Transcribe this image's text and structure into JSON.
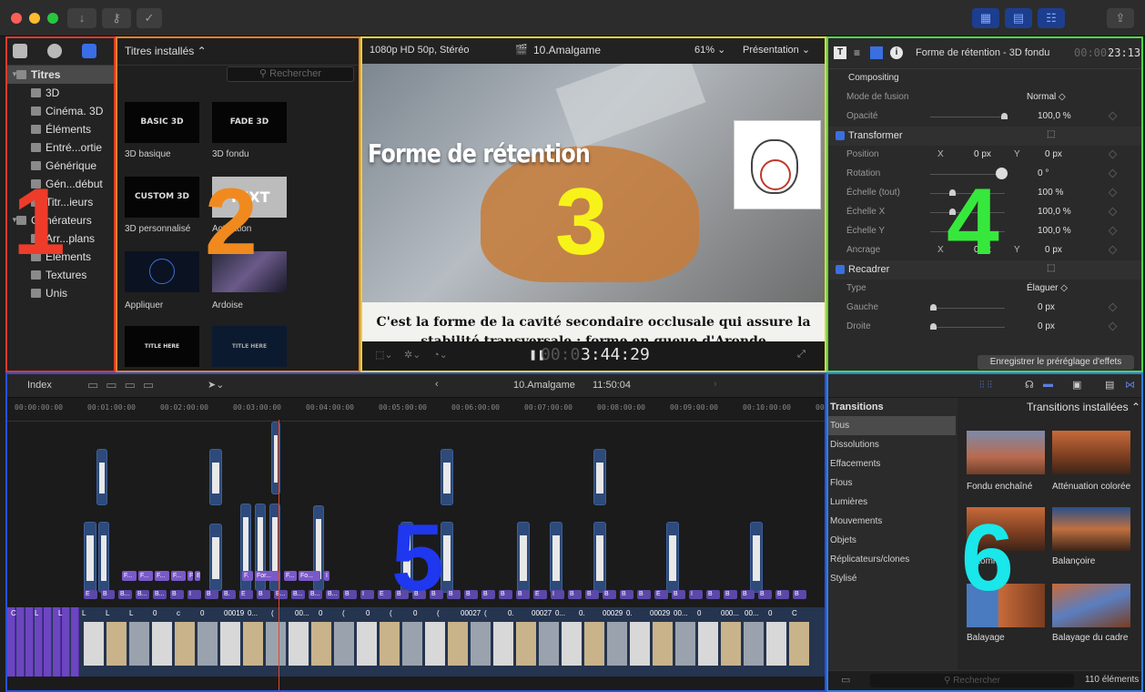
{
  "toolbar": {
    "import_icon": "download-arrow-icon",
    "keywords_icon": "key-icon",
    "background_tasks_icon": "checkmark-check-icon",
    "share_icon": "share-icon"
  },
  "sidebar": {
    "items": [
      {
        "label": "Titres",
        "level": 0,
        "selected": true,
        "expanded": true
      },
      {
        "label": "3D",
        "level": 1
      },
      {
        "label": "Cinéma. 3D",
        "level": 1
      },
      {
        "label": "Éléments",
        "level": 1
      },
      {
        "label": "Entré...ortie",
        "level": 1
      },
      {
        "label": "Générique",
        "level": 1
      },
      {
        "label": "Gén...début",
        "level": 1
      },
      {
        "label": "Titr...ieurs",
        "level": 1
      },
      {
        "label": "Générateurs",
        "level": 0,
        "expanded": true
      },
      {
        "label": "Arr...plans",
        "level": 1
      },
      {
        "label": "Éléments",
        "level": 1
      },
      {
        "label": "Textures",
        "level": 1
      },
      {
        "label": "Unis",
        "level": 1
      }
    ]
  },
  "titles_browser": {
    "header": "Titres installés",
    "search_placeholder": "Rechercher",
    "items": [
      {
        "thumb_text": "BASIC 3D",
        "label": "3D basique"
      },
      {
        "thumb_text": "FADE 3D",
        "label": "3D fondu"
      },
      {
        "thumb_text": "CUSTOM 3D",
        "label": "3D personnalisé"
      },
      {
        "thumb_text": "TEXT",
        "label": "Activation"
      },
      {
        "thumb_text": "",
        "label": "Appliquer"
      },
      {
        "thumb_text": "",
        "label": "Ardoise"
      },
      {
        "thumb_text": "TITLE HERE",
        "label": ""
      },
      {
        "thumb_text": "TITLE HERE",
        "label": ""
      }
    ]
  },
  "viewer": {
    "format": "1080p HD 50p, Stéréo",
    "project": "10.Amalgame",
    "zoom": "61%",
    "view_menu": "Présentation",
    "overlay_title": "Forme de rétention",
    "caption": "C'est la forme de la cavité secondaire occlusale qui assure la stabilité transversale : forme en queue d'Aronde",
    "timecode_dim": "00:0",
    "timecode": "3:44:29"
  },
  "inspector": {
    "title": "Forme de rétention - 3D fondu",
    "duration_dim": "00:00:",
    "duration": "23:13",
    "rows": [
      {
        "type": "header",
        "label": "Compositing"
      },
      {
        "type": "row",
        "label": "Mode de fusion",
        "value": "Normal ◇"
      },
      {
        "type": "slider",
        "label": "Opacité",
        "value": "100,0 %",
        "knob": 0.95
      },
      {
        "type": "section",
        "label": "Transformer"
      },
      {
        "type": "xy",
        "label": "Position",
        "x": "0 px",
        "y": "0 px"
      },
      {
        "type": "slider",
        "label": "Rotation",
        "value": "0 °",
        "knob": null
      },
      {
        "type": "slider",
        "label": "Échelle (tout)",
        "value": "100 %",
        "knob": 0.25
      },
      {
        "type": "slider",
        "label": "Échelle X",
        "value": "100,0 %",
        "knob": 0.25
      },
      {
        "type": "slider",
        "label": "Échelle Y",
        "value": "100,0 %",
        "knob": 0.25
      },
      {
        "type": "xy",
        "label": "Ancrage",
        "x": "0 px",
        "y": "0 px"
      },
      {
        "type": "section",
        "label": "Recadrer"
      },
      {
        "type": "row",
        "label": "Type",
        "value": "Élaguer ◇"
      },
      {
        "type": "slider",
        "label": "Gauche",
        "value": "0 px",
        "knob": 0.0
      },
      {
        "type": "slider",
        "label": "Droite",
        "value": "0 px",
        "knob": 0.0
      }
    ],
    "save_preset": "Enregistrer le préréglage d'effets"
  },
  "timeline": {
    "index_label": "Index",
    "project": "10.Amalgame",
    "duration": "11:50:04",
    "ruler": [
      "00:00:00:00",
      "00:01:00:00",
      "00:02:00:00",
      "00:03:00:00",
      "00:04:00:00",
      "00:05:00:00",
      "00:06:00:00",
      "00:07:00:00",
      "00:08:00:00",
      "00:09:00:00",
      "00:10:00:00",
      "00:"
    ],
    "title_chips": [
      "F...",
      "F...",
      "F...",
      "F...",
      "F",
      "E",
      "F.",
      "For...",
      "F...",
      "Fo...",
      "I"
    ],
    "trans_chips": [
      "E",
      "B",
      "B...",
      "B...",
      "B...",
      "B",
      "I",
      "B",
      "B.",
      "E",
      "B",
      "B...",
      "B...",
      "B...",
      "B...",
      "B",
      "I",
      "E",
      "B",
      "B",
      "B",
      "B",
      "B",
      "B",
      "B",
      "B",
      "E",
      "I",
      "B",
      "B",
      "B",
      "B",
      "B",
      "E",
      "B",
      "I",
      "B",
      "B",
      "B",
      "B",
      "B",
      "B"
    ],
    "clip_labels": [
      "C",
      "L",
      "L",
      "L",
      "L",
      "L",
      "0",
      "c",
      "0",
      "00019",
      "0...",
      "(",
      "00...",
      "0",
      "(",
      "0",
      "(",
      "0",
      "(",
      "00027",
      "(",
      "0.",
      "00027",
      "0...",
      "0.",
      "00029",
      "0.",
      "00029",
      "00...",
      "0",
      "000...",
      "00...",
      "0",
      "C"
    ]
  },
  "transitions_browser": {
    "header_left": "Transitions",
    "header_right": "Transitions installées",
    "categories": [
      {
        "label": "Tous",
        "selected": true
      },
      {
        "label": "Dissolutions"
      },
      {
        "label": "Effacements"
      },
      {
        "label": "Flous"
      },
      {
        "label": "Lumières"
      },
      {
        "label": "Mouvements"
      },
      {
        "label": "Objets"
      },
      {
        "label": "Réplicateurs/clones"
      },
      {
        "label": "Stylisé"
      }
    ],
    "items": [
      {
        "label": "Fondu enchaîné"
      },
      {
        "label": "Atténuation colorée"
      },
      {
        "label": "Automne"
      },
      {
        "label": "Balançoire"
      },
      {
        "label": "Balayage"
      },
      {
        "label": "Balayage du cadre"
      }
    ],
    "search_placeholder": "Rechercher",
    "count": "110 éléments"
  },
  "annotations": {
    "numbers": [
      "1",
      "2",
      "3",
      "4",
      "5",
      "6"
    ],
    "colors": [
      "#ef3b2a",
      "#f08a1e",
      "#f7f31a",
      "#37e83c",
      "#1f37ee",
      "#19e7ea"
    ]
  }
}
